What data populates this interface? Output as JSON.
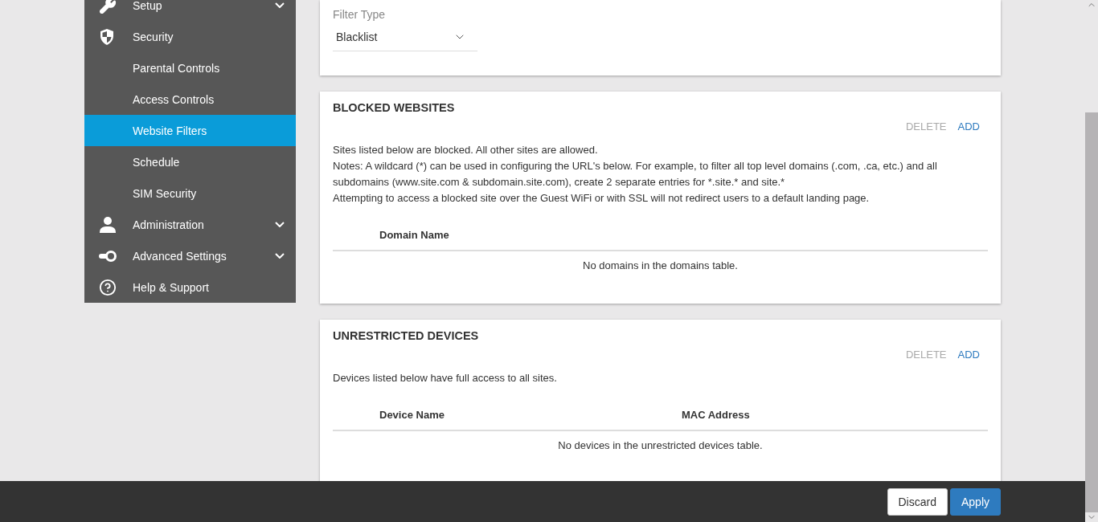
{
  "sidebar": {
    "items": [
      {
        "label": "Setup",
        "expandable": true,
        "selected": false
      },
      {
        "label": "Security",
        "expandable": false,
        "selected": false,
        "children": [
          {
            "label": "Parental Controls",
            "selected": false
          },
          {
            "label": "Access Controls",
            "selected": false
          },
          {
            "label": "Website Filters",
            "selected": true
          },
          {
            "label": "Schedule",
            "selected": false
          },
          {
            "label": "SIM Security",
            "selected": false
          }
        ]
      },
      {
        "label": "Administration",
        "expandable": true,
        "selected": false
      },
      {
        "label": "Advanced Settings",
        "expandable": true,
        "selected": false
      },
      {
        "label": "Help & Support",
        "expandable": false,
        "selected": false
      }
    ]
  },
  "filter_card": {
    "label": "Filter Type",
    "value": "Blacklist"
  },
  "cards": [
    {
      "title": "BLOCKED WEBSITES",
      "actions": [
        {
          "label": "DELETE",
          "disabled": true
        },
        {
          "label": "ADD",
          "disabled": false
        }
      ],
      "lines": [
        "Sites listed below are blocked. All other sites are allowed.",
        "Notes: A wildcard (*) can be used in configuring the URL's below. For example, to filter all top level domains (.com, .ca, etc.) and all subdomains (www.site.com & subdomain.site.com), create 2 separate entries for *.site.* and site.*",
        "Attempting to access a blocked site over the Guest WiFi or with SSL will not redirect users to a default landing page."
      ],
      "columns": [
        "Domain Name"
      ],
      "empty_message": "No domains in the domains table."
    },
    {
      "title": "UNRESTRICTED DEVICES",
      "actions": [
        {
          "label": "DELETE",
          "disabled": true
        },
        {
          "label": "ADD",
          "disabled": false
        }
      ],
      "lines": [
        "Devices listed below have full access to all sites."
      ],
      "columns": [
        "Device Name",
        "MAC Address"
      ],
      "empty_message": "No devices in the unrestricted devices table."
    }
  ],
  "footer": {
    "buttons": [
      {
        "label": "Discard",
        "kind": "secondary"
      },
      {
        "label": "Apply",
        "kind": "primary"
      }
    ]
  }
}
